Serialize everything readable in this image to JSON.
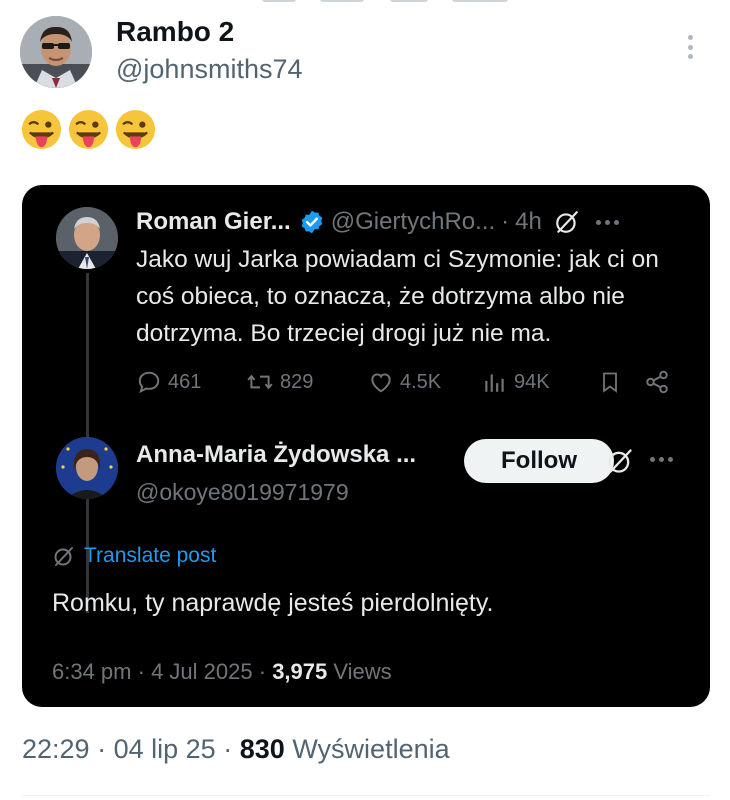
{
  "post": {
    "author_name": "Rambo 2",
    "author_handle": "@johnsmiths74",
    "emojis": [
      "😜",
      "😜",
      "😜"
    ],
    "avatar_icon": "avatar-photo-man-sunglasses",
    "more_icon": "vertical-dots-icon",
    "meta": {
      "time": "22:29",
      "date": "04 lip 25",
      "views_count": "830",
      "views_label": "Wyświetlenia",
      "separator": "·"
    }
  },
  "embed": {
    "quoted": {
      "author_name": "Roman Gier...",
      "author_handle": "@GiertychRo...",
      "time": "4h",
      "separator": "·",
      "text": "Jako wuj Jarka powiadam ci Szymonie: jak ci on coś obieca, to oznacza, że dotrzyma albo nie dotrzyma. Bo trzeciej drogi już nie ma.",
      "stats": {
        "replies": "461",
        "reposts": "829",
        "likes": "4.5K",
        "views": "94K"
      }
    },
    "reply": {
      "author_name": "Anna-Maria Żydowska ...",
      "author_handle": "@okoye8019971979",
      "follow_label": "Follow",
      "translate_label": "Translate post",
      "text": "Romku, ty naprawdę jesteś pierdolnięty.",
      "meta": {
        "time": "6:34 pm",
        "date": "4 Jul 2025",
        "views_count": "3,975",
        "views_label": "Views",
        "separator": "·"
      }
    }
  },
  "colors": {
    "embed_bg": "#000000",
    "link_blue": "#1d9bf0",
    "secondary_text_dark": "#71767b",
    "secondary_text_light": "#536471",
    "verified_blue": "#1d9bf0"
  }
}
